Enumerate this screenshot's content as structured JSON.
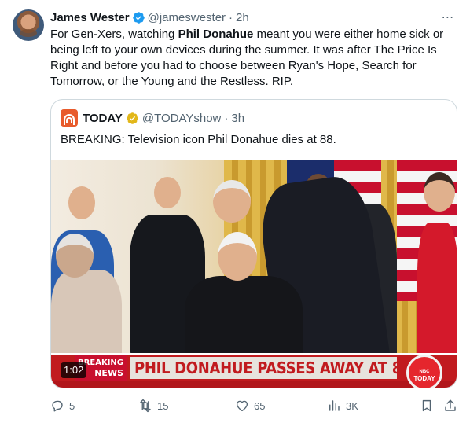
{
  "tweet": {
    "author_name": "James Wester",
    "author_handle": "@jameswester",
    "separator": "·",
    "time": "2h",
    "text_part1": "For Gen-Xers, watching ",
    "text_bold": "Phil Donahue",
    "text_part2": " meant you were either home sick or being left to your own devices during the summer. It was after The Price Is Right and before you had to choose between Ryan's Hope, Search for Tomorrow, or the Young and the Restless. RIP.",
    "more_icon": "⋯"
  },
  "quote": {
    "author_name": "TODAY",
    "author_handle": "@TODAYshow",
    "separator": "·",
    "time": "3h",
    "text": "BREAKING: Television icon Phil Donahue dies at 88.",
    "video": {
      "breaking_label_1": "BREAKING",
      "breaking_label_2": "NEWS",
      "headline": "PHIL DONAHUE PASSES AWAY AT 88",
      "logo_text_1": "TODAY",
      "logo_text_2": "NBC",
      "duration": "1:02"
    }
  },
  "actions": {
    "replies": "5",
    "reposts": "15",
    "likes": "65",
    "views": "3K"
  },
  "colors": {
    "verified_blue": "#1d9bf0",
    "verified_gold": "#e2b719",
    "text_secondary": "#536471",
    "border": "#cfd9de",
    "today_orange": "#e85b2c",
    "news_red": "#c11b1f"
  }
}
